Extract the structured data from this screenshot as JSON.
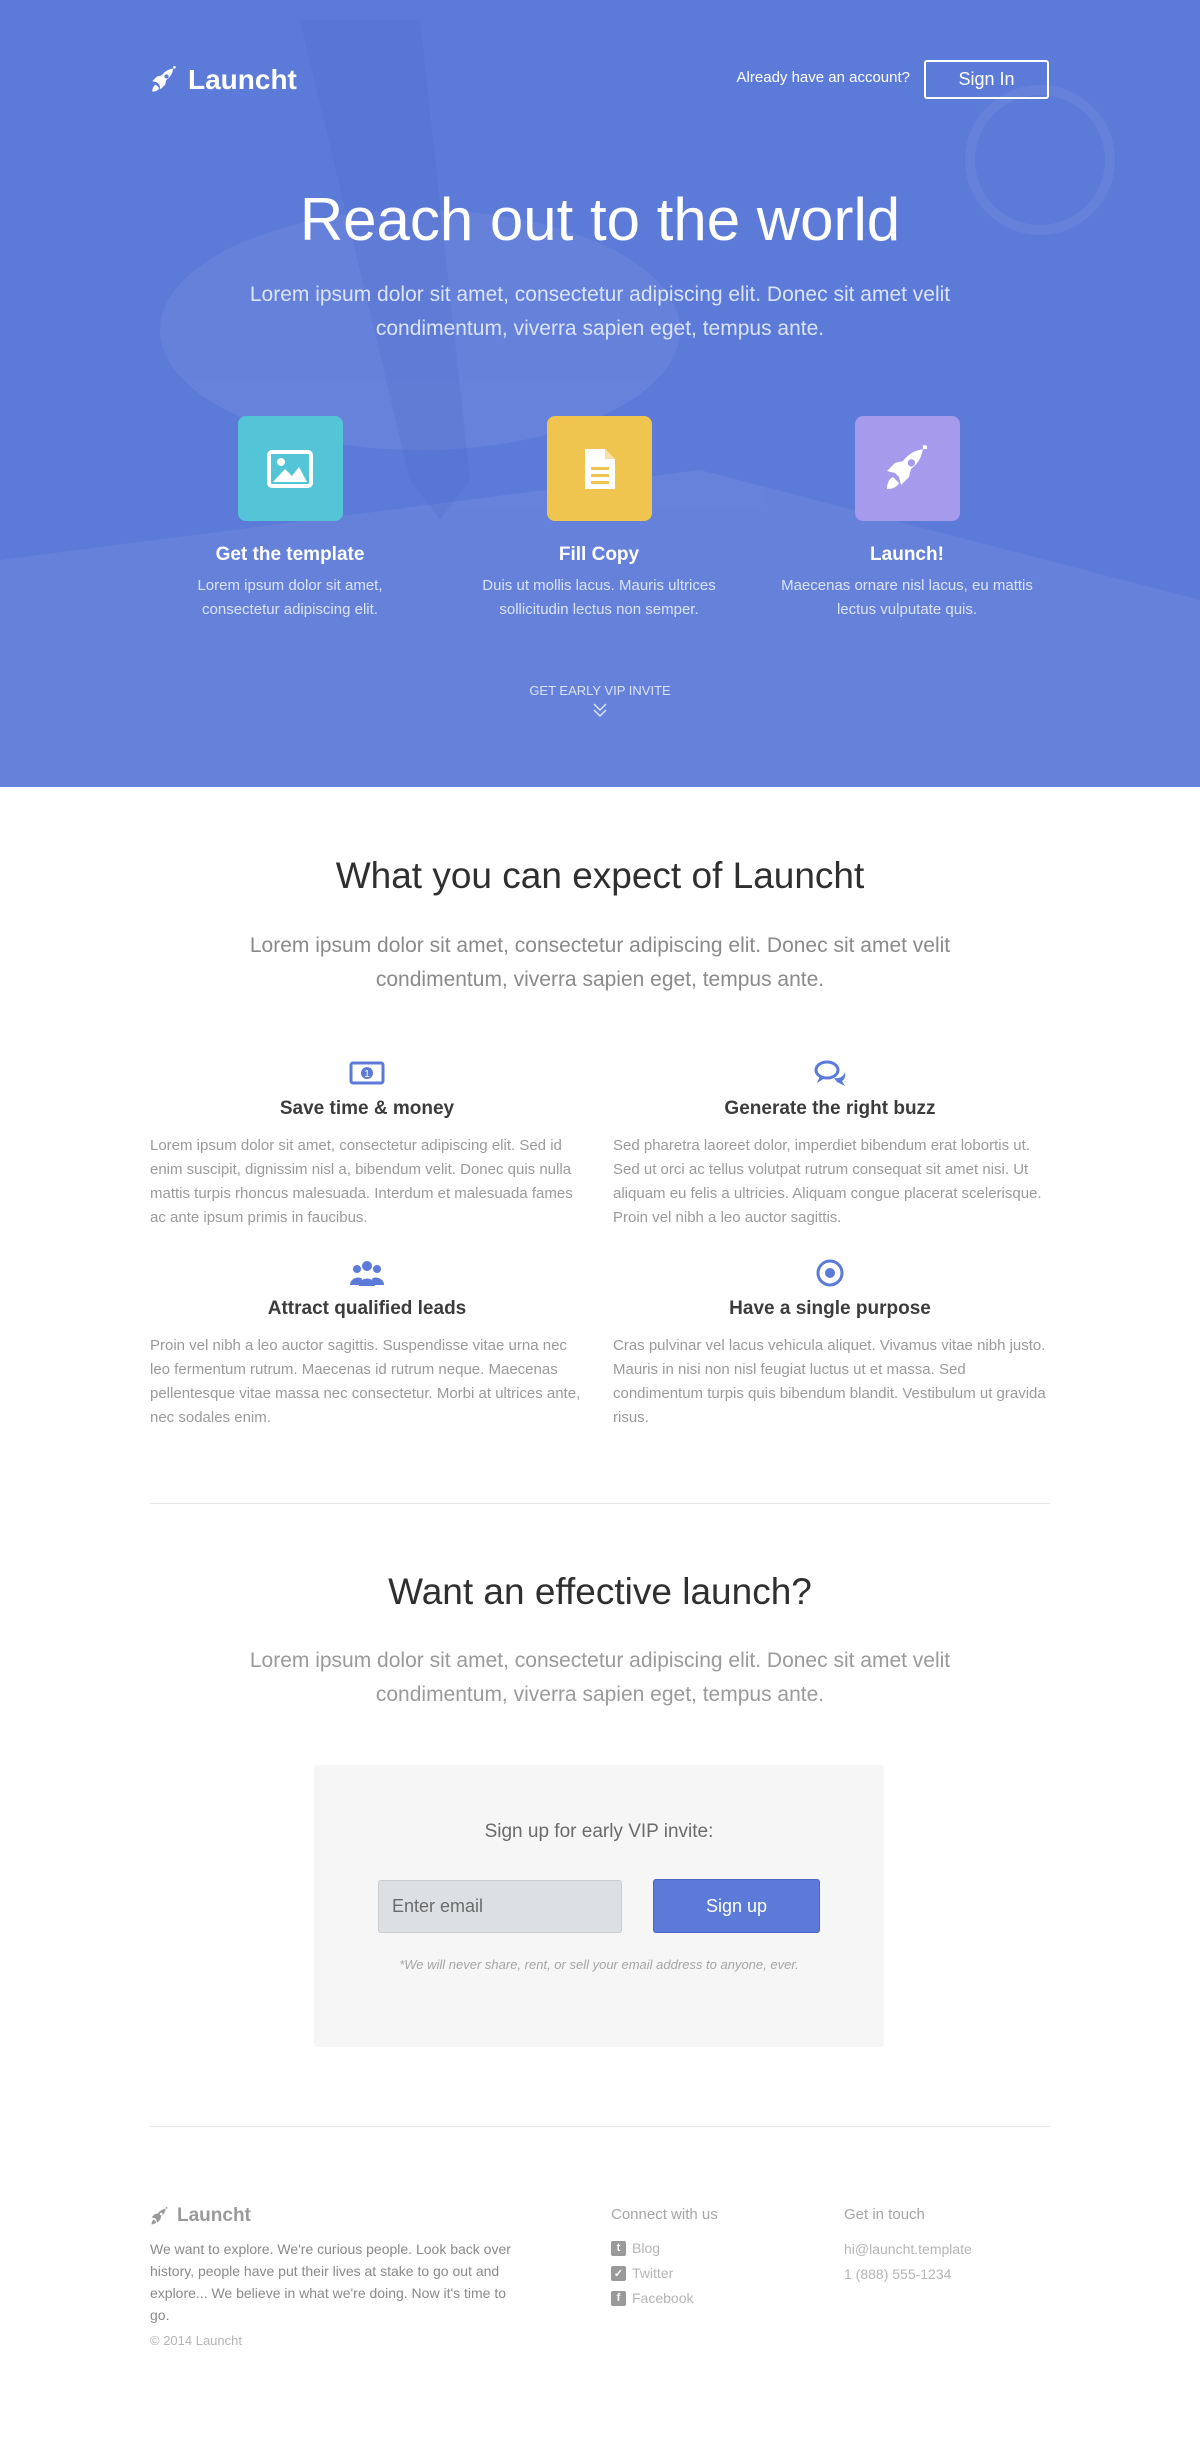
{
  "colors": {
    "hero_bg": "#5c7ad8",
    "accent": "#5c7ad8",
    "teal_tile": "#54c5d6",
    "yellow_tile": "#efc44f",
    "purple_tile": "#a59aec"
  },
  "header": {
    "brand": "Launcht",
    "account_prompt": "Already have an account?",
    "signin_label": "Sign In"
  },
  "hero": {
    "title": "Reach out to the world",
    "lead": "Lorem ipsum dolor sit amet, consectetur adipiscing elit. Donec sit amet velit condimentum, viverra sapien eget, tempus ante.",
    "steps": [
      {
        "icon": "image-icon",
        "title": "Get the template",
        "text": "Lorem ipsum dolor sit amet, consectetur adipiscing elit."
      },
      {
        "icon": "document-icon",
        "title": "Fill Copy",
        "text": "Duis ut mollis lacus. Mauris ultrices sollicitudin lectus non semper."
      },
      {
        "icon": "rocket-icon",
        "title": "Launch!",
        "text": "Maecenas ornare nisl lacus, eu mattis lectus vulputate quis."
      }
    ],
    "vip_link": "GET EARLY VIP INVITE"
  },
  "features": {
    "title": "What you can expect of Launcht",
    "lead": "Lorem ipsum dolor sit amet, consectetur adipiscing elit. Donec sit amet velit condimentum, viverra sapien eget, tempus ante.",
    "items": [
      {
        "icon": "money-icon",
        "title": "Save time & money",
        "text": "Lorem ipsum dolor sit amet, consectetur adipiscing elit. Sed id enim suscipit, dignissim nisl a, bibendum velit. Donec quis nulla mattis turpis rhoncus malesuada. Interdum et malesuada fames ac ante ipsum primis in faucibus."
      },
      {
        "icon": "chat-bubbles-icon",
        "title": "Generate the right buzz",
        "text": "Sed pharetra laoreet dolor, imperdiet bibendum erat lobortis ut. Sed ut orci ac tellus volutpat rutrum consequat sit amet nisi. Ut aliquam eu felis a ultricies. Aliquam congue placerat scelerisque. Proin vel nibh a leo auctor sagittis."
      },
      {
        "icon": "users-icon",
        "title": "Attract qualified leads",
        "text": "Proin vel nibh a leo auctor sagittis. Suspendisse vitae urna nec leo fermentum rutrum. Maecenas id rutrum neque. Maecenas pellentesque vitae massa nec consectetur. Morbi at ultrices ante, nec sodales enim."
      },
      {
        "icon": "target-icon",
        "title": "Have a single purpose",
        "text": "Cras pulvinar vel lacus vehicula aliquet. Vivamus vitae nibh justo. Mauris in nisi non nisl feugiat luctus ut et massa. Sed condimentum turpis quis bibendum blandit. Vestibulum ut gravida risus."
      }
    ]
  },
  "launch": {
    "title": "Want an effective launch?",
    "lead": "Lorem ipsum dolor sit amet, consectetur adipiscing elit. Donec sit amet velit condimentum, viverra sapien eget, tempus ante.",
    "signup_title": "Sign up for early VIP invite:",
    "email_placeholder": "Enter email",
    "signup_button": "Sign up",
    "note": "*We will never share, rent, or sell your email address to anyone, ever."
  },
  "footer": {
    "brand": "Launcht",
    "about": "We want to explore. We're curious people. Look back over history, people have put their lives at stake to go out and explore... We believe in what we're doing. Now it's time to go.",
    "copyright": "© 2014 Launcht",
    "connect_title": "Connect with us",
    "social": [
      {
        "icon": "tumblr-icon",
        "label": "Blog"
      },
      {
        "icon": "twitter-icon",
        "label": "Twitter"
      },
      {
        "icon": "facebook-icon",
        "label": "Facebook"
      }
    ],
    "contact_title": "Get in touch",
    "email": "hi@launcht.template",
    "phone": "1 (888) 555-1234"
  }
}
